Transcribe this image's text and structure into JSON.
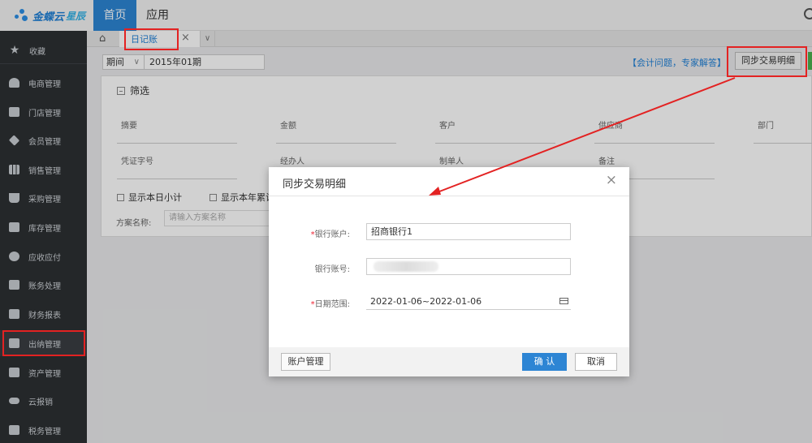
{
  "header": {
    "brand": "金蝶云",
    "brand_sub": "星辰",
    "nav": [
      {
        "label": "首页",
        "active": true
      },
      {
        "label": "应用",
        "active": false
      }
    ]
  },
  "sidebar": {
    "items": [
      {
        "label": "收藏",
        "icon": "star-icon"
      },
      {
        "label": "电商管理",
        "icon": "user-icon"
      },
      {
        "label": "门店管理",
        "icon": "store-icon"
      },
      {
        "label": "会员管理",
        "icon": "diamond-icon"
      },
      {
        "label": "销售管理",
        "icon": "bar-chart-icon"
      },
      {
        "label": "采购管理",
        "icon": "cart-icon"
      },
      {
        "label": "库存管理",
        "icon": "box-icon"
      },
      {
        "label": "应收应付",
        "icon": "coin-icon"
      },
      {
        "label": "账务处理",
        "icon": "ledger-icon"
      },
      {
        "label": "财务报表",
        "icon": "report-icon"
      },
      {
        "label": "出纳管理",
        "icon": "cashier-icon",
        "active": true
      },
      {
        "label": "资产管理",
        "icon": "asset-icon"
      },
      {
        "label": "云报销",
        "icon": "cloud-icon"
      },
      {
        "label": "税务管理",
        "icon": "tax-icon"
      }
    ]
  },
  "tabs": {
    "journal_label": "日记账",
    "close": "×",
    "more": "∨"
  },
  "toolbar": {
    "period_label": "期间",
    "period_value": "2015年01期",
    "expert_link": "【会计问题，专家解答】",
    "sync_button": "同步交易明细"
  },
  "filter": {
    "title": "筛选",
    "fields": [
      "摘要",
      "金额",
      "客户",
      "供应商",
      "部门",
      "凭证字号",
      "经办人",
      "制单人",
      "备注"
    ],
    "checkboxes": [
      "显示本日小计",
      "显示本年累计"
    ],
    "scheme_label": "方案名称:",
    "scheme_placeholder": "请输入方案名称"
  },
  "modal": {
    "title": "同步交易明细",
    "close": "×",
    "bank_account_label": "银行账户:",
    "bank_account_value": "招商银行1",
    "bank_number_label": "银行账号:",
    "date_range_label": "日期范围:",
    "date_range_value": "2022-01-06~2022-01-06",
    "required_mark": "*",
    "account_mgmt_button": "账户管理",
    "confirm_button": "确 认",
    "cancel_button": "取消"
  },
  "colors": {
    "accent": "#2d85d4",
    "sidebar_bg": "#2d3033",
    "annotation_red": "#e32222"
  }
}
